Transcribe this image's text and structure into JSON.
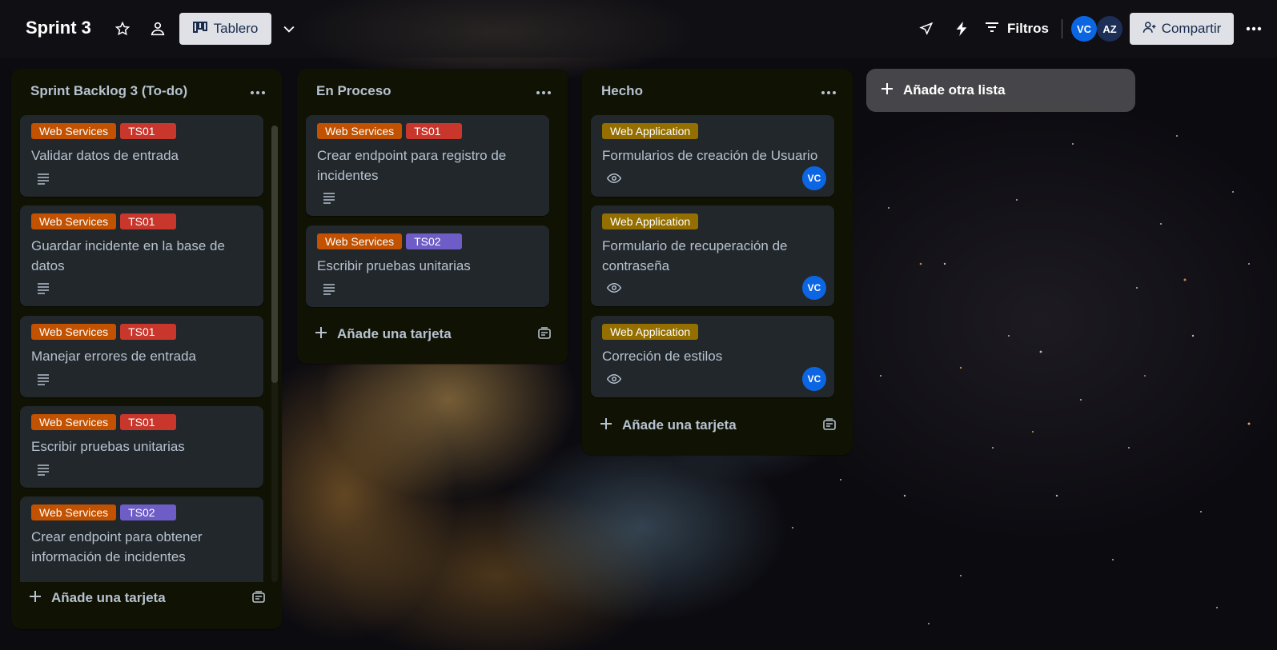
{
  "colors": {
    "label_web_services": "#c25100",
    "label_ts01": "#c9372c",
    "label_ts02": "#6e5dc6",
    "label_web_application": "#946f00",
    "avatar_vc": "#0c66e4",
    "avatar_az": "#1d2f56"
  },
  "header": {
    "board_title": "Sprint 3",
    "star_icon": "star-icon",
    "visibility_icon": "workspace-visibility-icon",
    "view_label": "Tablero",
    "view_icon": "board-icon",
    "chevron_icon": "chevron-down-icon",
    "powerups_icon": "rocket-icon",
    "automation_icon": "lightning-icon",
    "filters_label": "Filtros",
    "members": [
      {
        "initials": "VC"
      },
      {
        "initials": "AZ"
      }
    ],
    "share_label": "Compartir",
    "more_icon": "more-icon"
  },
  "lists": [
    {
      "title": "Sprint Backlog 3 (To-do)",
      "add_card": "Añade una tarjeta",
      "cards": [
        {
          "labels": [
            "Web Services",
            "TS01"
          ],
          "title": "Validar datos de entrada",
          "badge": "description-icon"
        },
        {
          "labels": [
            "Web Services",
            "TS01"
          ],
          "title": "Guardar incidente en la base de datos",
          "badge": "description-icon"
        },
        {
          "labels": [
            "Web Services",
            "TS01"
          ],
          "title": "Manejar errores de entrada",
          "badge": "description-icon"
        },
        {
          "labels": [
            "Web Services",
            "TS01"
          ],
          "title": "Escribir pruebas unitarias",
          "badge": "description-icon"
        },
        {
          "labels": [
            "Web Services",
            "TS02"
          ],
          "title": "Crear endpoint para obtener información de incidentes",
          "badge": ""
        }
      ]
    },
    {
      "title": "En Proceso",
      "add_card": "Añade una tarjeta",
      "cards": [
        {
          "labels": [
            "Web Services",
            "TS01"
          ],
          "title": "Crear endpoint para registro de incidentes",
          "badge": "description-icon"
        },
        {
          "labels": [
            "Web Services",
            "TS02"
          ],
          "title": "Escribir pruebas unitarias",
          "badge": "description-icon"
        }
      ]
    },
    {
      "title": "Hecho",
      "add_card": "Añade una tarjeta",
      "cards": [
        {
          "labels": [
            "Web Application"
          ],
          "title": "Formularios de creación de Usuario",
          "badge": "eye-icon",
          "member": "VC"
        },
        {
          "labels": [
            "Web Application"
          ],
          "title": "Formulario de recuperación de contraseña",
          "badge": "eye-icon",
          "member": "VC"
        },
        {
          "labels": [
            "Web Application"
          ],
          "title": "Correción de estilos",
          "badge": "eye-icon",
          "member": "VC"
        }
      ]
    }
  ],
  "add_list": "Añade otra lista"
}
